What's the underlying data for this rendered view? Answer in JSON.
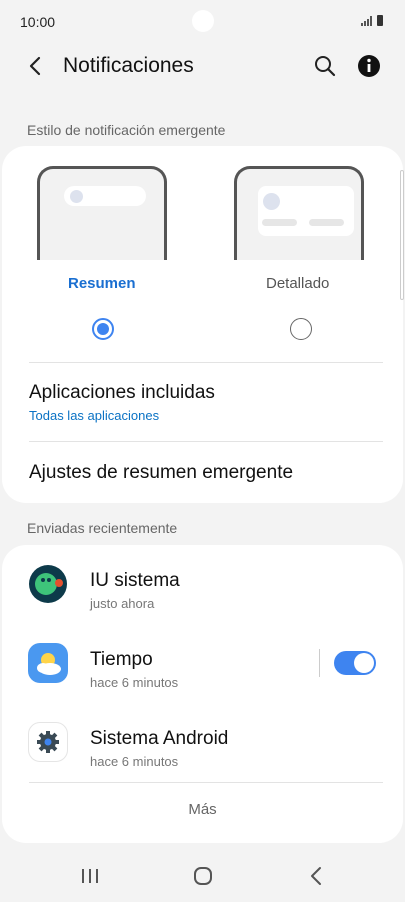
{
  "status_bar": {
    "time": "10:00"
  },
  "header": {
    "title": "Notificaciones"
  },
  "popup_style": {
    "section_label": "Estilo de notificación emergente",
    "options": [
      {
        "label": "Resumen",
        "selected": true
      },
      {
        "label": "Detallado",
        "selected": false
      }
    ]
  },
  "settings": {
    "included_apps": {
      "title": "Aplicaciones incluidas",
      "value": "Todas las aplicaciones"
    },
    "summary_settings": {
      "title": "Ajustes de resumen emergente"
    }
  },
  "recent": {
    "section_label": "Enviadas recientemente",
    "apps": [
      {
        "name": "IU sistema",
        "time": "justo ahora",
        "icon": "system-ui-icon"
      },
      {
        "name": "Tiempo",
        "time": "hace 6 minutos",
        "icon": "weather-icon",
        "toggle_on": true
      },
      {
        "name": "Sistema Android",
        "time": "hace 6 minutos",
        "icon": "android-system-icon"
      }
    ],
    "more_label": "Más"
  },
  "colors": {
    "accent": "#3e84f0",
    "link": "#0a72c4",
    "background": "#f3f3f3",
    "card": "#ffffff"
  }
}
